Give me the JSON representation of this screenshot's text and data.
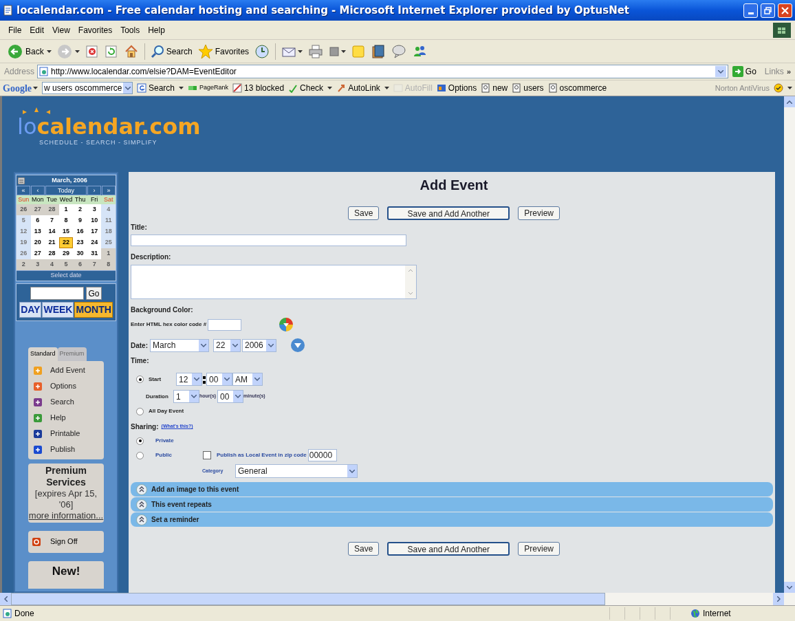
{
  "window": {
    "title": "localendar.com - Free calendar hosting and searching - Microsoft Internet Explorer provided by OptusNet"
  },
  "menu": [
    "File",
    "Edit",
    "View",
    "Favorites",
    "Tools",
    "Help"
  ],
  "toolbar": {
    "back": "Back",
    "search": "Search",
    "favorites": "Favorites"
  },
  "address": {
    "label": "Address",
    "url": "http://www.localendar.com/elsie?DAM=EventEditor",
    "go": "Go",
    "links": "Links",
    "more": "»"
  },
  "google_bar": {
    "brand": "Google",
    "query": "w users oscommerce",
    "norton": "Norton AntiVirus",
    "items": [
      {
        "label": "Search",
        "disabled": false
      },
      {
        "label": "PageRank",
        "disabled": false
      },
      {
        "label": "13 blocked",
        "disabled": false
      },
      {
        "label": "Check",
        "disabled": false
      },
      {
        "label": "AutoLink",
        "disabled": false
      },
      {
        "label": "AutoFill",
        "disabled": true
      },
      {
        "label": "Options",
        "disabled": false
      },
      {
        "label": "new",
        "disabled": false
      },
      {
        "label": "users",
        "disabled": false
      },
      {
        "label": "oscommerce",
        "disabled": false
      }
    ]
  },
  "logo": {
    "prefix": "lo",
    "name": "calendar.com",
    "tagline": "SCHEDULE - SEARCH - SIMPLIFY"
  },
  "mini_calendar": {
    "month": "March, 2006",
    "nav": [
      "«",
      "‹",
      "Today",
      "›",
      "»"
    ],
    "weekdays": [
      {
        "label": "Sun",
        "weekend": true
      },
      {
        "label": "Mon",
        "weekend": false
      },
      {
        "label": "Tue",
        "weekend": false
      },
      {
        "label": "Wed",
        "weekend": false
      },
      {
        "label": "Thu",
        "weekend": false
      },
      {
        "label": "Fri",
        "weekend": false
      },
      {
        "label": "Sat",
        "weekend": true
      }
    ],
    "weeks": [
      [
        {
          "day": "26",
          "kind": "other",
          "selected": false
        },
        {
          "day": "27",
          "kind": "other",
          "selected": false
        },
        {
          "day": "28",
          "kind": "other",
          "selected": false
        },
        {
          "day": "1",
          "kind": "weekday",
          "selected": false
        },
        {
          "day": "2",
          "kind": "weekday",
          "selected": false
        },
        {
          "day": "3",
          "kind": "weekday",
          "selected": false
        },
        {
          "day": "4",
          "kind": "weekend",
          "selected": false
        }
      ],
      [
        {
          "day": "5",
          "kind": "weekend",
          "selected": false
        },
        {
          "day": "6",
          "kind": "weekday",
          "selected": false
        },
        {
          "day": "7",
          "kind": "weekday",
          "selected": false
        },
        {
          "day": "8",
          "kind": "weekday",
          "selected": false
        },
        {
          "day": "9",
          "kind": "weekday",
          "selected": false
        },
        {
          "day": "10",
          "kind": "weekday",
          "selected": false
        },
        {
          "day": "11",
          "kind": "weekend",
          "selected": false
        }
      ],
      [
        {
          "day": "12",
          "kind": "weekend",
          "selected": false
        },
        {
          "day": "13",
          "kind": "weekday",
          "selected": false
        },
        {
          "day": "14",
          "kind": "weekday",
          "selected": false
        },
        {
          "day": "15",
          "kind": "weekday",
          "selected": false
        },
        {
          "day": "16",
          "kind": "weekday",
          "selected": false
        },
        {
          "day": "17",
          "kind": "weekday",
          "selected": false
        },
        {
          "day": "18",
          "kind": "weekend",
          "selected": false
        }
      ],
      [
        {
          "day": "19",
          "kind": "weekend",
          "selected": false
        },
        {
          "day": "20",
          "kind": "weekday",
          "selected": false
        },
        {
          "day": "21",
          "kind": "weekday",
          "selected": false
        },
        {
          "day": "22",
          "kind": "weekday",
          "selected": true
        },
        {
          "day": "23",
          "kind": "weekday",
          "selected": false
        },
        {
          "day": "24",
          "kind": "weekday",
          "selected": false
        },
        {
          "day": "25",
          "kind": "weekend",
          "selected": false
        }
      ],
      [
        {
          "day": "26",
          "kind": "weekend",
          "selected": false
        },
        {
          "day": "27",
          "kind": "weekday",
          "selected": false
        },
        {
          "day": "28",
          "kind": "weekday",
          "selected": false
        },
        {
          "day": "29",
          "kind": "weekday",
          "selected": false
        },
        {
          "day": "30",
          "kind": "weekday",
          "selected": false
        },
        {
          "day": "31",
          "kind": "weekday",
          "selected": false
        },
        {
          "day": "1",
          "kind": "other",
          "selected": false
        }
      ],
      [
        {
          "day": "2",
          "kind": "other",
          "selected": false
        },
        {
          "day": "3",
          "kind": "other",
          "selected": false
        },
        {
          "day": "4",
          "kind": "other",
          "selected": false
        },
        {
          "day": "5",
          "kind": "other",
          "selected": false
        },
        {
          "day": "6",
          "kind": "other",
          "selected": false
        },
        {
          "day": "7",
          "kind": "other",
          "selected": false
        },
        {
          "day": "8",
          "kind": "other",
          "selected": false
        }
      ]
    ],
    "footer": "Select date"
  },
  "goto": {
    "button": "Go"
  },
  "views": [
    {
      "label": "DAY",
      "selected": false
    },
    {
      "label": "WEEK",
      "selected": false
    },
    {
      "label": "MONTH",
      "selected": true
    }
  ],
  "menu_tabs": [
    {
      "label": "Standard",
      "selected": true
    },
    {
      "label": "Premium",
      "selected": false
    }
  ],
  "menu_items": [
    {
      "label": "Add Event",
      "color": "#f0a020"
    },
    {
      "label": "Options",
      "color": "#e8602a"
    },
    {
      "label": "Search",
      "color": "#7a3b8c"
    },
    {
      "label": "Help",
      "color": "#3a9a3a"
    },
    {
      "label": "Printable",
      "color": "#1a3a9a"
    },
    {
      "label": "Publish",
      "color": "#1a4ad0"
    }
  ],
  "premium": {
    "title": "Premium Services",
    "note": "[expires Apr 15, '06]",
    "link": "more information..."
  },
  "sign_off": "Sign Off",
  "news": "New!",
  "form": {
    "heading": "Add Event",
    "top_buttons": [
      "Save",
      "Save and Add Another",
      "Preview"
    ],
    "title_label": "Title:",
    "description_label": "Description:",
    "background_label": "Background Color:",
    "hex_label": "Enter HTML hex color code #",
    "date_label": "Date:",
    "month": "March",
    "day": "22",
    "year": "2006",
    "time_label": "Time:",
    "time_options": [
      {
        "label": "Start",
        "selected": true
      },
      {
        "label": "All Day Event",
        "selected": false
      }
    ],
    "hour": "12",
    "minute": "00",
    "ampm": "AM",
    "duration_label": "Duration",
    "duration_hours": "1",
    "hours_unit": "hour(s)",
    "duration_minutes": "00",
    "minutes_unit": "minute(s)",
    "sharing_label": "Sharing:",
    "sharing_link": "(What's this?)",
    "sharing_options": [
      {
        "label": "Private",
        "selected": true
      },
      {
        "label": "Public",
        "selected": false
      }
    ],
    "publish": {
      "label": "Publish as Local Event in zip code",
      "checked": false
    },
    "zip": "00000",
    "category_label": "Category",
    "category": "General",
    "sections": [
      {
        "label": "Add an image to this event",
        "expanded": false
      },
      {
        "label": "This event repeats",
        "expanded": false
      },
      {
        "label": "Set a reminder",
        "expanded": false
      }
    ],
    "bottom_buttons": [
      "Save",
      "Save and Add Another",
      "Preview"
    ]
  },
  "status_bar": {
    "text": "Done",
    "zone": "Internet"
  }
}
